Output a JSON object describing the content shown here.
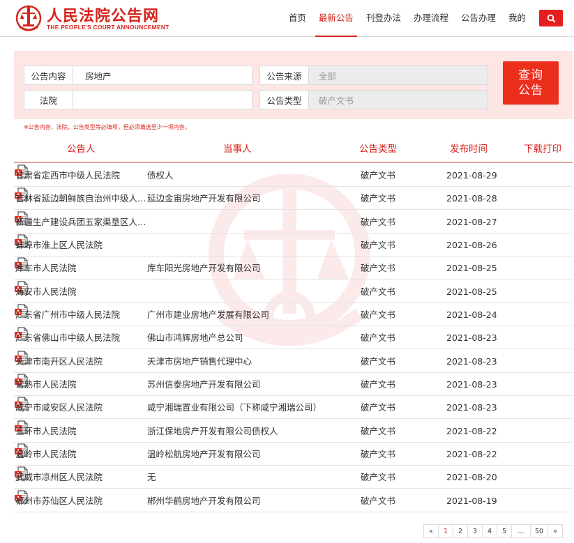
{
  "header": {
    "title": "人民法院公告网",
    "subtitle": "THE PEOPLE'S COURT ANNOUNCEMENT",
    "nav": [
      "首页",
      "最新公告",
      "刊登办法",
      "办理流程",
      "公告办理",
      "我的"
    ],
    "active_nav": "最新公告",
    "search_icon": "search-icon"
  },
  "filter": {
    "content_label": "公告内容",
    "content_value": "房地产",
    "source_label": "公告来源",
    "source_value": "全部",
    "court_label": "法院",
    "court_value": "",
    "type_label": "公告类型",
    "type_value": "破产文书",
    "query_line1": "查询",
    "query_line2": "公告",
    "hint": "※公告内容，法院，公告类型等必填项，但必须填选至少一项内容。"
  },
  "table": {
    "headers": [
      "公告人",
      "当事人",
      "公告类型",
      "发布时间",
      "下载打印"
    ],
    "rows": [
      {
        "court": "甘肃省定西市中级人民法院",
        "party": "债权人",
        "type": "破产文书",
        "date": "2021-08-29"
      },
      {
        "court": "吉林省延边朝鲜族自治州中级人民...",
        "party": "延边金宙房地产开发有限公司",
        "type": "破产文书",
        "date": "2021-08-28"
      },
      {
        "court": "新疆生产建设兵团五家渠垦区人民...",
        "party": "",
        "type": "破产文书",
        "date": "2021-08-27"
      },
      {
        "court": "蚌埠市淮上区人民法院",
        "party": "",
        "type": "破产文书",
        "date": "2021-08-26"
      },
      {
        "court": "库车市人民法院",
        "party": "库车阳光房地产开发有限公司",
        "type": "破产文书",
        "date": "2021-08-25"
      },
      {
        "court": "海安市人民法院",
        "party": "",
        "type": "破产文书",
        "date": "2021-08-25"
      },
      {
        "court": "广东省广州市中级人民法院",
        "party": "广州市建业房地产发展有限公司",
        "type": "破产文书",
        "date": "2021-08-24"
      },
      {
        "court": "广东省佛山市中级人民法院",
        "party": "佛山市鸿辉房地产总公司",
        "type": "破产文书",
        "date": "2021-08-23"
      },
      {
        "court": "天津市南开区人民法院",
        "party": "天津市房地产销售代理中心",
        "type": "破产文书",
        "date": "2021-08-23"
      },
      {
        "court": "常熟市人民法院",
        "party": "苏州信泰房地产开发有限公司",
        "type": "破产文书",
        "date": "2021-08-23"
      },
      {
        "court": "咸宁市咸安区人民法院",
        "party": "咸宁湘瑞置业有限公司（下称咸宁湘瑞公司）",
        "type": "破产文书",
        "date": "2021-08-23"
      },
      {
        "court": "玉环市人民法院",
        "party": "浙江保地房产开发有限公司债权人",
        "type": "破产文书",
        "date": "2021-08-22"
      },
      {
        "court": "温岭市人民法院",
        "party": "温岭松航房地产开发有限公司",
        "type": "破产文书",
        "date": "2021-08-22"
      },
      {
        "court": "武威市凉州区人民法院",
        "party": "无",
        "type": "破产文书",
        "date": "2021-08-20"
      },
      {
        "court": "郴州市苏仙区人民法院",
        "party": "郴州华鹤房地产开发有限公司",
        "type": "破产文书",
        "date": "2021-08-19"
      }
    ],
    "download_icon": "pdf-download-icon"
  },
  "pagination": [
    "«",
    "1",
    "2",
    "3",
    "4",
    "5",
    "...",
    "50",
    "»"
  ],
  "current_page": "1",
  "colors": {
    "brand_red": "#d7231d",
    "button_red": "#ec2e1d",
    "panel_pink": "#fde6e3"
  }
}
